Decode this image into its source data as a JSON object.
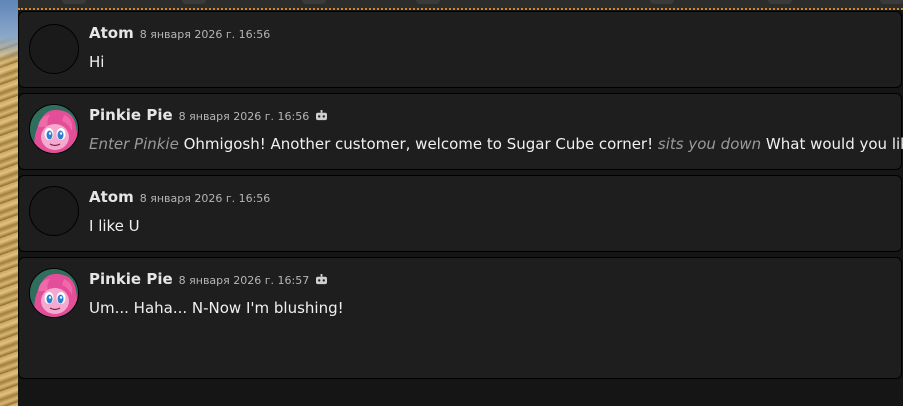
{
  "colors": {
    "background": "#151515",
    "message_bg": "#1e1e1e",
    "author": "#e6e6e6",
    "timestamp": "#b5b5b5",
    "text": "#f0f0f0",
    "action_text": "#9a9a9a",
    "accent_dotted": "#d08a1e"
  },
  "top_bar": {
    "icons": [
      "menu-icon",
      "character-icon",
      "image-icon",
      "chat-icon",
      "settings-icon",
      "extensions-icon",
      "user-icon"
    ]
  },
  "messages": [
    {
      "author": "Atom",
      "timestamp": "8 января 2026 г. 16:56",
      "avatar": "blank-avatar",
      "is_bot": false,
      "text": "Hi"
    },
    {
      "author": "Pinkie Pie",
      "timestamp": "8 января 2026 г. 16:56",
      "avatar": "pinkie-pie-avatar",
      "is_bot": true,
      "segments": [
        {
          "type": "action",
          "text": "Enter Pinkie"
        },
        {
          "type": "text",
          "text": " Ohmigosh! Another customer, welcome to Sugar Cube corner! "
        },
        {
          "type": "action",
          "text": "sits you down"
        },
        {
          "type": "text",
          "text": " What would you like?"
        }
      ]
    },
    {
      "author": "Atom",
      "timestamp": "8 января 2026 г. 16:56",
      "avatar": "blank-avatar",
      "is_bot": false,
      "text": "I like U"
    },
    {
      "author": "Pinkie Pie",
      "timestamp": "8 января 2026 г. 16:57",
      "avatar": "pinkie-pie-avatar",
      "is_bot": true,
      "text": "Um... Haha... N-Now I'm blushing!"
    }
  ]
}
